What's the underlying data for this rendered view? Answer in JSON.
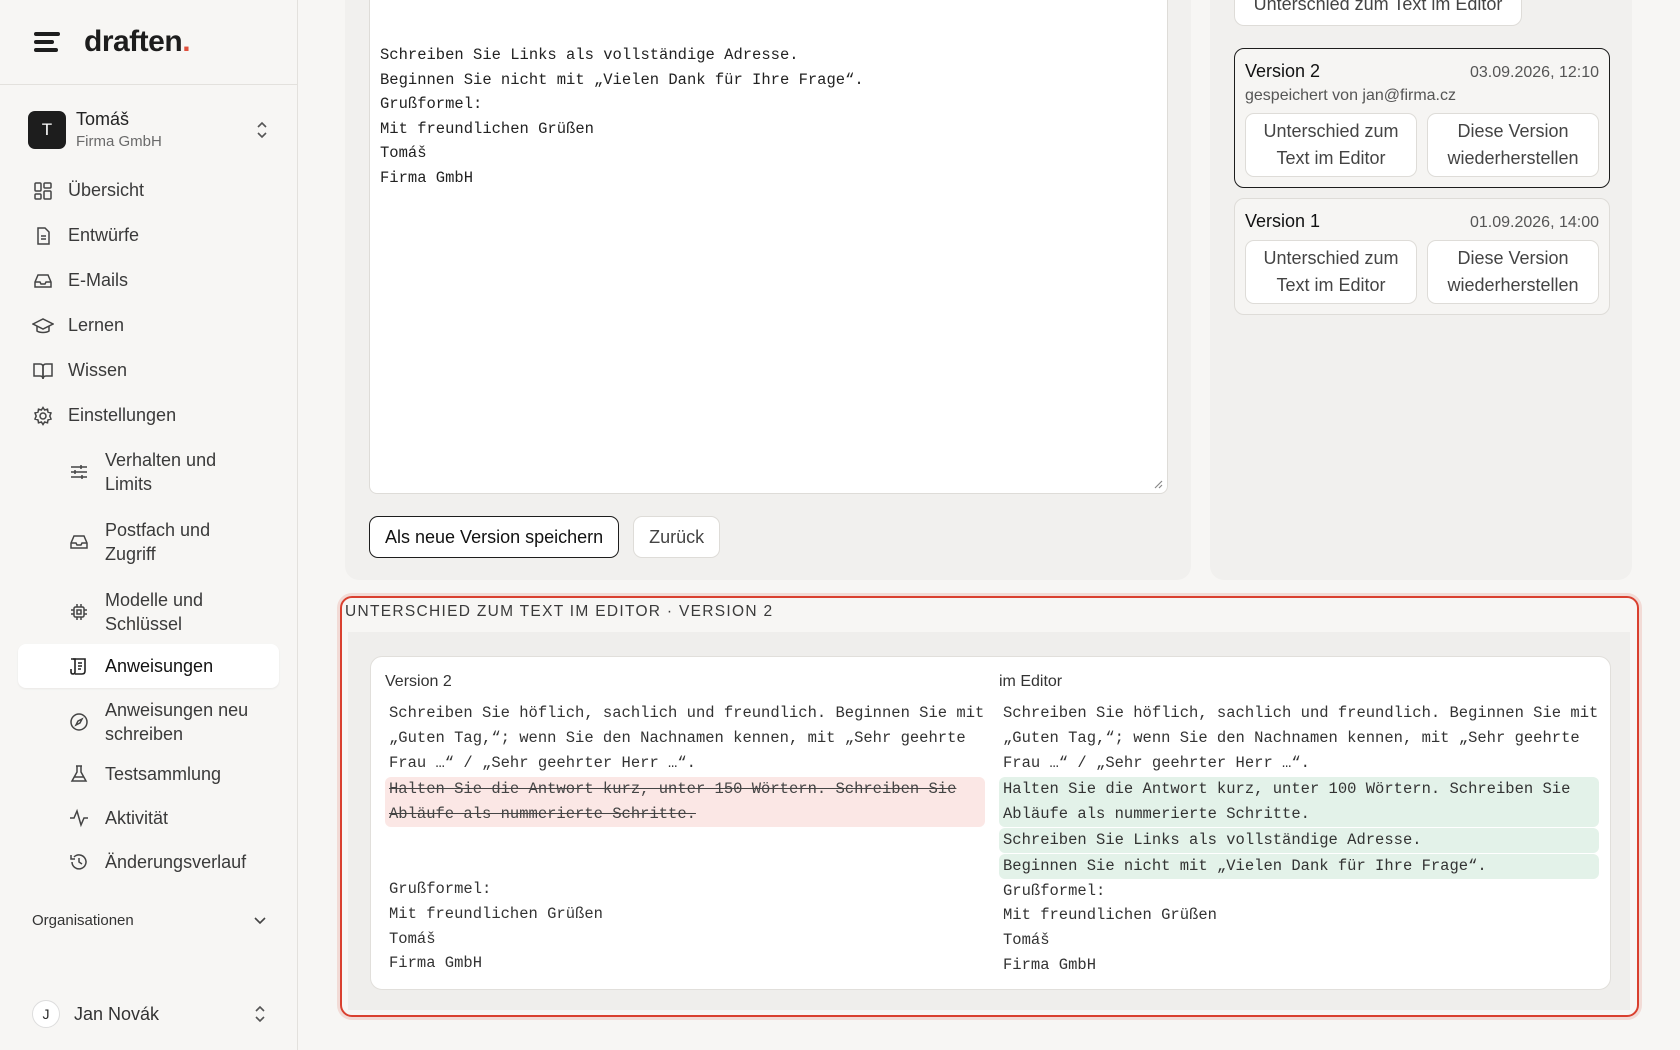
{
  "app": {
    "logo_text": "draften",
    "logo_dot": "."
  },
  "account": {
    "initial": "T",
    "name": "Tomáš",
    "org": "Firma GmbH"
  },
  "nav": {
    "overview": "Übersicht",
    "drafts": "Entwürfe",
    "emails": "E-Mails",
    "learn": "Lernen",
    "knowledge": "Wissen",
    "settings": "Einstellungen",
    "behavior": [
      "Verhalten und",
      "Limits"
    ],
    "mailbox": [
      "Postfach und",
      "Zugriff"
    ],
    "models": [
      "Modelle und",
      "Schlüssel"
    ],
    "instructions": "Anweisungen",
    "rewrite": [
      "Anweisungen neu",
      "schreiben"
    ],
    "tests": "Testsammlung",
    "activity": "Aktivität",
    "history": "Änderungsverlauf",
    "organizations": "Organisationen"
  },
  "user": {
    "initial": "J",
    "name": "Jan Novák"
  },
  "editor": {
    "text": "Schreiben Sie Links als vollständige Adresse.\nBeginnen Sie nicht mit „Vielen Dank für Ihre Frage“.\nGrußformel:\nMit freundlichen Grüßen\nTomáš\nFirma GmbH",
    "save_label": "Als neue Version speichern",
    "back_label": "Zurück"
  },
  "versions": {
    "top_button": "Unterschied zum Text im Editor",
    "items": [
      {
        "title": "Version 2",
        "date": "03.09.2026, 12:10",
        "by": "gespeichert von jan@firma.cz",
        "diff_label": [
          "Unterschied zum",
          "Text im Editor"
        ],
        "restore_label": [
          "Diese Version",
          "wiederherstellen"
        ]
      },
      {
        "title": "Version 1",
        "date": "01.09.2026, 14:00",
        "by": "",
        "diff_label": [
          "Unterschied zum",
          "Text im Editor"
        ],
        "restore_label": [
          "Diese Version",
          "wiederherstellen"
        ]
      }
    ]
  },
  "diff": {
    "section_title": "UNTERSCHIED ZUM TEXT IM EDITOR · VERSION 2",
    "left_title": "Version 2",
    "right_title": "im Editor",
    "common_top": [
      "Schreiben Sie höflich, sachlich und freundlich. Beginnen Sie mit",
      "„Guten Tag,“; wenn Sie den Nachnamen kennen, mit „Sehr geehrte",
      "Frau …“ / „Sehr geehrter Herr …“."
    ],
    "removed": [
      "Halten Sie die Antwort kurz, unter 150 Wörtern. Schreiben Sie",
      "Abläufe als nummerierte Schritte."
    ],
    "added_block": [
      "Halten Sie die Antwort kurz, unter 100 Wörtern. Schreiben Sie",
      "Abläufe als nummerierte Schritte."
    ],
    "added_line_1": "Schreiben Sie Links als vollständige Adresse.",
    "added_line_2": "Beginnen Sie nicht mit „Vielen Dank für Ihre Frage“.",
    "common_bottom": [
      "Grußformel:",
      "Mit freundlichen Grüßen",
      "Tomáš",
      "Firma GmbH"
    ]
  }
}
